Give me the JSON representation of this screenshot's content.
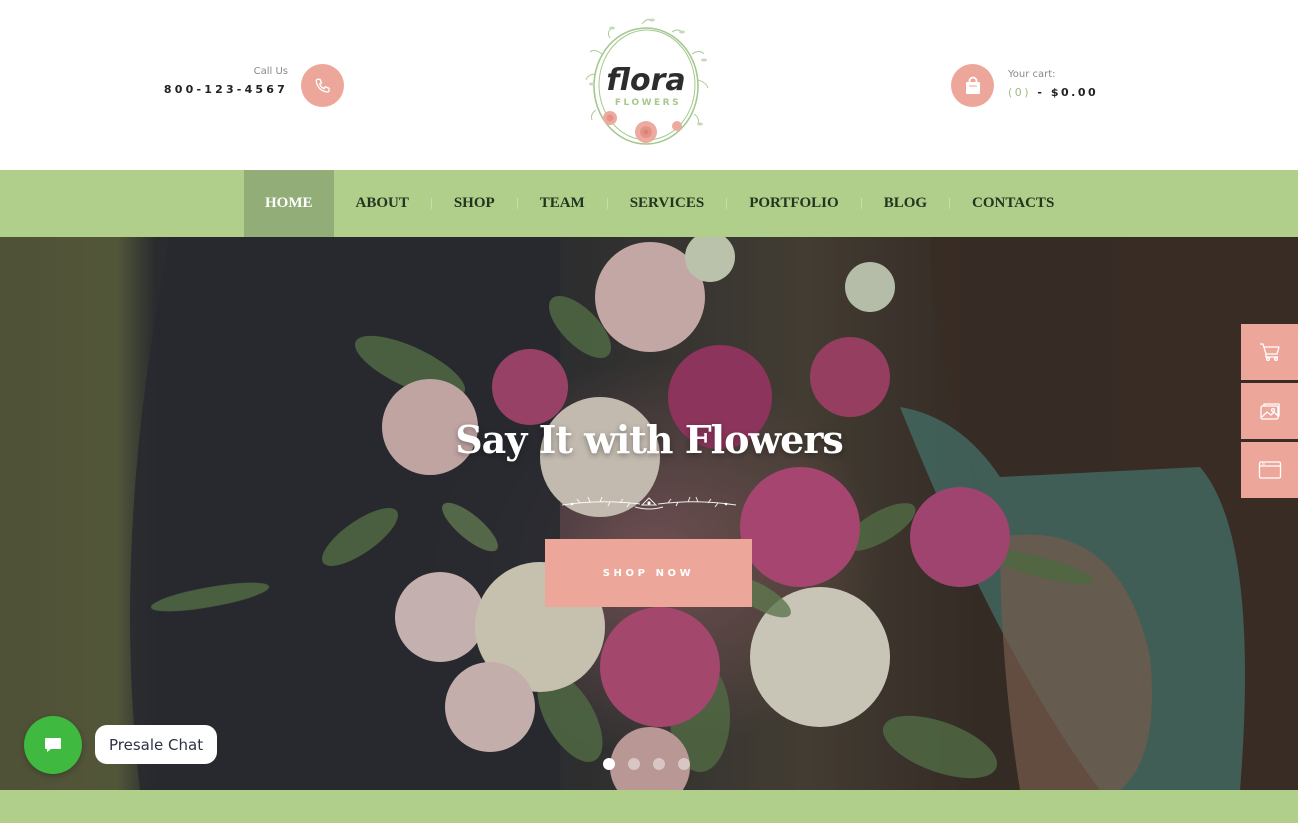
{
  "header": {
    "call_label": "Call Us",
    "phone": "800-123-4567",
    "logo": {
      "title": "flora",
      "subtitle": "FLOWERS"
    },
    "cart_label": "Your cart:",
    "cart_count": "(0)",
    "cart_separator": " - ",
    "cart_total": "$0.00"
  },
  "nav": {
    "items": [
      {
        "label": "Home",
        "active": true
      },
      {
        "label": "About"
      },
      {
        "label": "Shop"
      },
      {
        "label": "Team"
      },
      {
        "label": "Services"
      },
      {
        "label": "Portfolio"
      },
      {
        "label": "Blog"
      },
      {
        "label": "Contacts"
      }
    ]
  },
  "hero": {
    "title": "Say It with Flowers",
    "cta_label": "SHOP NOW",
    "slides_total": 4,
    "active_slide": 1
  },
  "side_tools": [
    {
      "icon": "cart-icon"
    },
    {
      "icon": "images-icon"
    },
    {
      "icon": "browser-window-icon"
    }
  ],
  "chat": {
    "label": "Presale Chat"
  },
  "colors": {
    "accent_pink": "#eda69a",
    "nav_green": "#afcf8b",
    "nav_active": "#92ad78",
    "chat_green": "#3fb93f"
  }
}
